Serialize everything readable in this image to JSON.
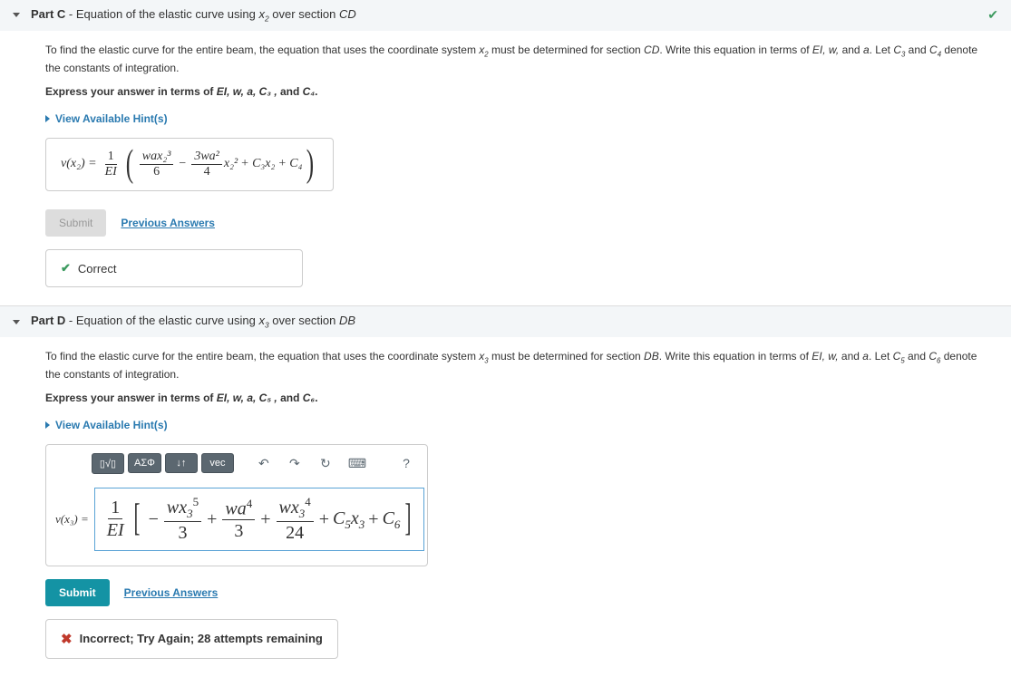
{
  "common": {
    "hints_label": "View Available Hint(s)",
    "submit_label": "Submit",
    "prev_answers_label": "Previous Answers",
    "help_q": "?"
  },
  "partC": {
    "title_label": "Part C",
    "title_desc_prefix": " - Equation of the elastic curve using ",
    "title_var": "x",
    "title_sub": "2",
    "title_desc_suffix": " over section ",
    "title_section": "CD",
    "desc_1": "To find the elastic curve for the entire beam, the equation that uses the coordinate system ",
    "desc_x": "x",
    "desc_xsub": "2",
    "desc_2": " must be determined for section ",
    "desc_3": ". Write this equation in terms of ",
    "desc_vars": "EI, w,",
    "desc_4": " and ",
    "desc_a": "a",
    "desc_5": ". Let ",
    "desc_c3": "C",
    "desc_c3sub": "3",
    "desc_6": " and ",
    "desc_c4": "C",
    "desc_c4sub": "4",
    "desc_7": " denote the constants of integration.",
    "express_1": "Express your answer in terms of ",
    "express_vars": "EI, w, a,  C₃ ,",
    "express_2": " and ",
    "express_c": "C₄",
    "express_3": ".",
    "lhs": "v(x₂) = ",
    "frac1_num": "1",
    "frac1_den": "EI",
    "frac2_num": "wax₂³",
    "frac2_den": "6",
    "frac3_num": "3wa²",
    "frac3_den": "4",
    "term1": "x₂²",
    "plus": " + ",
    "term2": "C₃x₂",
    "term3": "C₄",
    "minus": " − ",
    "feedback": "Correct"
  },
  "partD": {
    "title_label": "Part D",
    "title_desc_prefix": " - Equation of the elastic curve using ",
    "title_var": "x",
    "title_sub": "3",
    "title_desc_suffix": " over section ",
    "title_section": "DB",
    "desc_1": "To find the elastic curve for the entire beam, the equation that uses the coordinate system ",
    "desc_x": "x",
    "desc_xsub": "3",
    "desc_2": " must be determined for section ",
    "desc_3": ". Write this equation in terms of ",
    "desc_vars": "EI, w,",
    "desc_4": " and ",
    "desc_a": "a",
    "desc_5": ". Let ",
    "desc_c5": "C",
    "desc_c5sub": "5",
    "desc_6": " and ",
    "desc_c6": "C",
    "desc_c6sub": "6",
    "desc_7": " denote the constants of integration.",
    "express_1": "Express your answer in terms of ",
    "express_vars": "EI, w, a, C₅ ,",
    "express_2": " and ",
    "express_c": "C₆",
    "express_3": ".",
    "toolbar": {
      "tpl": "▯√▯",
      "greek": "ΑΣΦ",
      "arrows": "↓↑",
      "vec": "vec",
      "undo": "↶",
      "redo": "↷",
      "reset": "↻",
      "keyboard": "⌨"
    },
    "lhs_v": "v(x₃) = ",
    "frac1_num": "1",
    "frac1_den": "EI",
    "t1_num_a": "wx",
    "t1_num_sub": "3",
    "t1_num_sup": "5",
    "t1_den": "3",
    "t2_num_a": "wa",
    "t2_num_sup": "4",
    "t2_den": "3",
    "t3_num_a": "wx",
    "t3_num_sub": "3",
    "t3_num_sup": "4",
    "t3_den": "24",
    "c5_c": "C",
    "c5_sub": "5",
    "c5_x": "x",
    "c5_xsub": "3",
    "c6_c": "C",
    "c6_sub": "6",
    "minus": "−",
    "plus": "+",
    "feedback": "Incorrect; Try Again; 28 attempts remaining"
  }
}
